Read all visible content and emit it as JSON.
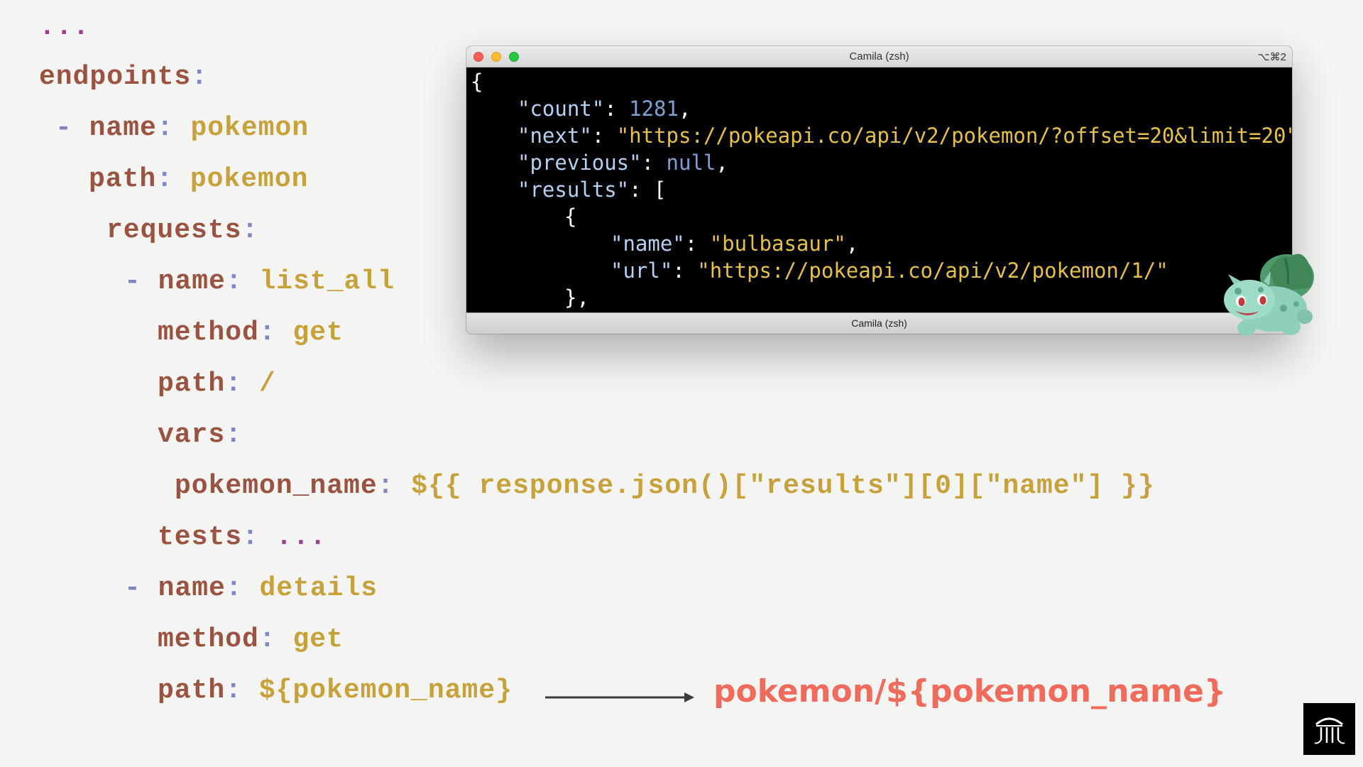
{
  "yaml": {
    "lines": [
      [
        {
          "t": "...",
          "c": "d"
        }
      ],
      [
        {
          "t": "endpoints",
          "c": "k"
        },
        {
          "t": ":",
          "c": "p"
        }
      ],
      [
        {
          "t": "- ",
          "c": "p"
        },
        {
          "t": "name",
          "c": "k"
        },
        {
          "t": ": ",
          "c": "p"
        },
        {
          "t": "pokemon",
          "c": "v"
        }
      ],
      [
        {
          "t": "path",
          "c": "k"
        },
        {
          "t": ": ",
          "c": "p"
        },
        {
          "t": "pokemon",
          "c": "v"
        }
      ],
      [
        {
          "t": "requests",
          "c": "k"
        },
        {
          "t": ":",
          "c": "p"
        }
      ],
      [
        {
          "t": "- ",
          "c": "p"
        },
        {
          "t": "name",
          "c": "k"
        },
        {
          "t": ": ",
          "c": "p"
        },
        {
          "t": "list_all",
          "c": "v"
        }
      ],
      [
        {
          "t": "method",
          "c": "k"
        },
        {
          "t": ": ",
          "c": "p"
        },
        {
          "t": "get",
          "c": "v"
        }
      ],
      [
        {
          "t": "path",
          "c": "k"
        },
        {
          "t": ": ",
          "c": "p"
        },
        {
          "t": "/",
          "c": "v"
        }
      ],
      [
        {
          "t": "vars",
          "c": "k"
        },
        {
          "t": ":",
          "c": "p"
        }
      ],
      [
        {
          "t": "pokemon_name",
          "c": "k"
        },
        {
          "t": ": ",
          "c": "p"
        },
        {
          "t": "${{ response.json()[\"results\"][0][\"name\"] }}",
          "c": "v"
        }
      ],
      [
        {
          "t": "tests",
          "c": "k"
        },
        {
          "t": ": ",
          "c": "p"
        },
        {
          "t": "...",
          "c": "d"
        }
      ],
      [
        {
          "t": "- ",
          "c": "p"
        },
        {
          "t": "name",
          "c": "k"
        },
        {
          "t": ": ",
          "c": "p"
        },
        {
          "t": "details",
          "c": "v"
        }
      ],
      [
        {
          "t": "method",
          "c": "k"
        },
        {
          "t": ": ",
          "c": "p"
        },
        {
          "t": "get",
          "c": "v"
        }
      ],
      [
        {
          "t": "path",
          "c": "k"
        },
        {
          "t": ": ",
          "c": "p"
        },
        {
          "t": "${pokemon_name}",
          "c": "v"
        }
      ]
    ]
  },
  "terminal": {
    "title": "Camila (zsh)",
    "shortcut": "⌥⌘2",
    "status": "Camila (zsh)",
    "lines": [
      [
        {
          "t": "{",
          "c": "jw"
        }
      ],
      [
        {
          "t": "\"count\"",
          "c": "jk"
        },
        {
          "t": ": ",
          "c": "jw"
        },
        {
          "t": "1281",
          "c": "jn"
        },
        {
          "t": ",",
          "c": "jw"
        }
      ],
      [
        {
          "t": "\"next\"",
          "c": "jk"
        },
        {
          "t": ": ",
          "c": "jw"
        },
        {
          "t": "\"https://pokeapi.co/api/v2/pokemon/?offset=20&limit=20\"",
          "c": "js"
        },
        {
          "t": ",",
          "c": "jw"
        }
      ],
      [
        {
          "t": "\"previous\"",
          "c": "jk"
        },
        {
          "t": ": ",
          "c": "jw"
        },
        {
          "t": "null",
          "c": "jn"
        },
        {
          "t": ",",
          "c": "jw"
        }
      ],
      [
        {
          "t": "\"results\"",
          "c": "jk"
        },
        {
          "t": ": [",
          "c": "jw"
        }
      ],
      [
        {
          "t": "{",
          "c": "jw"
        }
      ],
      [
        {
          "t": "\"name\"",
          "c": "jk"
        },
        {
          "t": ": ",
          "c": "jw"
        },
        {
          "t": "\"bulbasaur\"",
          "c": "js"
        },
        {
          "t": ",",
          "c": "jw"
        }
      ],
      [
        {
          "t": "\"url\"",
          "c": "jk"
        },
        {
          "t": ": ",
          "c": "jw"
        },
        {
          "t": "\"https://pokeapi.co/api/v2/pokemon/1/\"",
          "c": "js"
        }
      ],
      [
        {
          "t": "},",
          "c": "jw"
        }
      ]
    ]
  },
  "annotation": {
    "result_path": "pokemon/${pokemon_name}"
  },
  "colors": {
    "key": "#9a5340",
    "punct": "#7f86c7",
    "value": "#c7a23a",
    "ellipsis": "#9b3e8f",
    "accent": "#f06b5b"
  }
}
